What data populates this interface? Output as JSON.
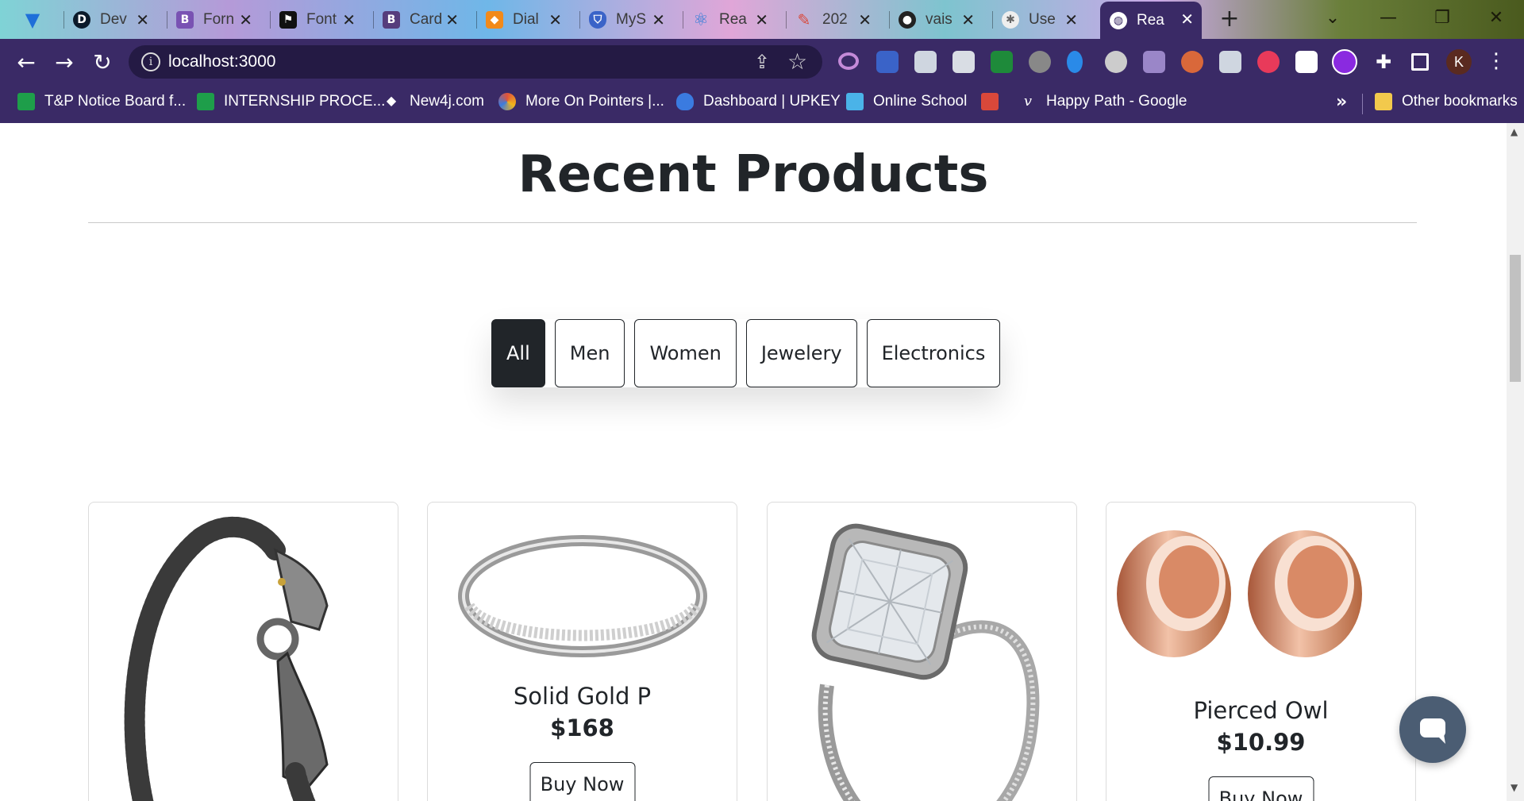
{
  "browser": {
    "tabs": [
      {
        "title": "",
        "icon": "vuetify-icon"
      },
      {
        "title": "Dev",
        "icon": "dev-d-icon"
      },
      {
        "title": "Forn",
        "icon": "bootstrap-b-icon"
      },
      {
        "title": "Font",
        "icon": "flag-icon"
      },
      {
        "title": "Card",
        "icon": "bootstrap-b-icon"
      },
      {
        "title": "Dial",
        "icon": "cube-icon"
      },
      {
        "title": "MyS",
        "icon": "shield-icon"
      },
      {
        "title": "Rea",
        "icon": "react-icon"
      },
      {
        "title": "202",
        "icon": "brush-icon"
      },
      {
        "title": "vais",
        "icon": "github-icon"
      },
      {
        "title": "Use",
        "icon": "gear-icon"
      },
      {
        "title": "Rea",
        "icon": "globe-icon",
        "active": true
      }
    ],
    "url": "localhost:3000",
    "profile_initial": "K",
    "bookmarks": [
      {
        "label": "T&P Notice Board f...",
        "color": "#1e9e4a"
      },
      {
        "label": "INTERNSHIP PROCE...",
        "color": "#1e9e4a"
      },
      {
        "label": "New4j.com",
        "color": "#ffffff"
      },
      {
        "label": "More On Pointers |...",
        "color": "#e0533a"
      },
      {
        "label": "Dashboard | UPKEY",
        "color": "#3a7be0"
      },
      {
        "label": "Online School",
        "color": "#4ab3e8"
      },
      {
        "label": "",
        "color": "#d9483a"
      },
      {
        "label": "Happy Path - Google",
        "color": "#ffffff"
      }
    ],
    "bookmarks_more": "»",
    "other_bookmarks": "Other bookmarks"
  },
  "page": {
    "heading": "Recent Products",
    "filters": [
      {
        "label": "All",
        "active": true
      },
      {
        "label": "Men",
        "active": false
      },
      {
        "label": "Women",
        "active": false
      },
      {
        "label": "Jewelery",
        "active": false
      },
      {
        "label": "Electronics",
        "active": false
      }
    ],
    "products": [
      {
        "title": "",
        "price": "",
        "button": "",
        "image": "silver-dragon-bracelet"
      },
      {
        "title": "Solid Gold P",
        "price": "$168",
        "button": "Buy Now",
        "image": "silver-eternity-band"
      },
      {
        "title": "",
        "price": "",
        "button": "",
        "image": "diamond-engagement-ring"
      },
      {
        "title": "Pierced Owl",
        "price": "$10.99",
        "button": "Buy Now",
        "image": "rose-gold-tunnel-plugs"
      }
    ]
  },
  "colors": {
    "browser_theme": "#3a2a66",
    "active_filter_bg": "#212529",
    "chat_button": "#4b5d73"
  }
}
